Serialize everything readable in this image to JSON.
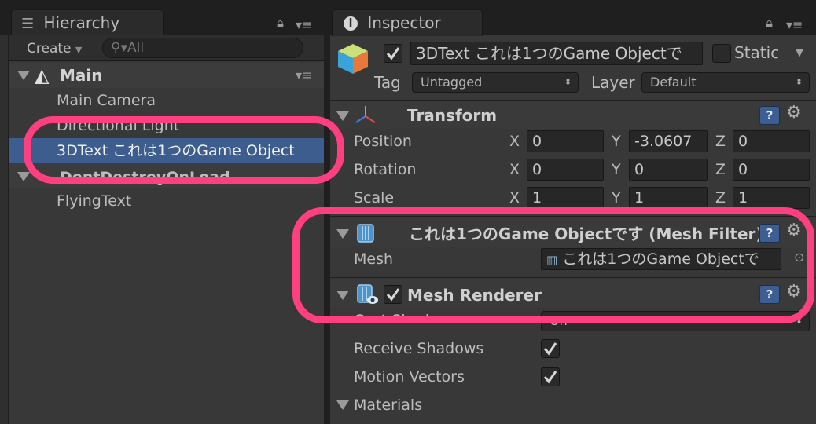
{
  "hierarchy": {
    "tab_label": "Hierarchy",
    "create_label": "Create",
    "search_placeholder": "All",
    "scene_name": "Main",
    "items": [
      {
        "label": "Main Camera"
      },
      {
        "label": "Directional Light"
      },
      {
        "label": "3DText これは1つのGame Object"
      },
      {
        "label": "DontDestroyOnLoad"
      },
      {
        "label": "FlyingText"
      }
    ]
  },
  "inspector": {
    "tab_label": "Inspector",
    "object_name": "3DText これは1つのGame Objectで",
    "static_label": "Static",
    "tag_label": "Tag",
    "tag_value": "Untagged",
    "layer_label": "Layer",
    "layer_value": "Default",
    "transform": {
      "title": "Transform",
      "rows": [
        {
          "label": "Position",
          "x": "0",
          "y": "-3.0607",
          "z": "0"
        },
        {
          "label": "Rotation",
          "x": "0",
          "y": "0",
          "z": "0"
        },
        {
          "label": "Scale",
          "x": "1",
          "y": "1",
          "z": "1"
        }
      ],
      "axis_x": "X",
      "axis_y": "Y",
      "axis_z": "Z"
    },
    "mesh_filter": {
      "title": "これは1つのGame Objectです (Mesh Filter)",
      "mesh_label": "Mesh",
      "mesh_value": "これは1つのGame Objectで"
    },
    "mesh_renderer": {
      "title": "Mesh Renderer",
      "cast_shadows_label": "Cast Shadows",
      "cast_shadows_value": "On",
      "receive_shadows_label": "Receive Shadows",
      "motion_vectors_label": "Motion Vectors",
      "materials_label": "Materials"
    },
    "help_glyph": "?",
    "gear_glyph": "⚙"
  },
  "colors": {
    "highlight": "#ff3f80",
    "selected_row": "#3d5d8f"
  }
}
